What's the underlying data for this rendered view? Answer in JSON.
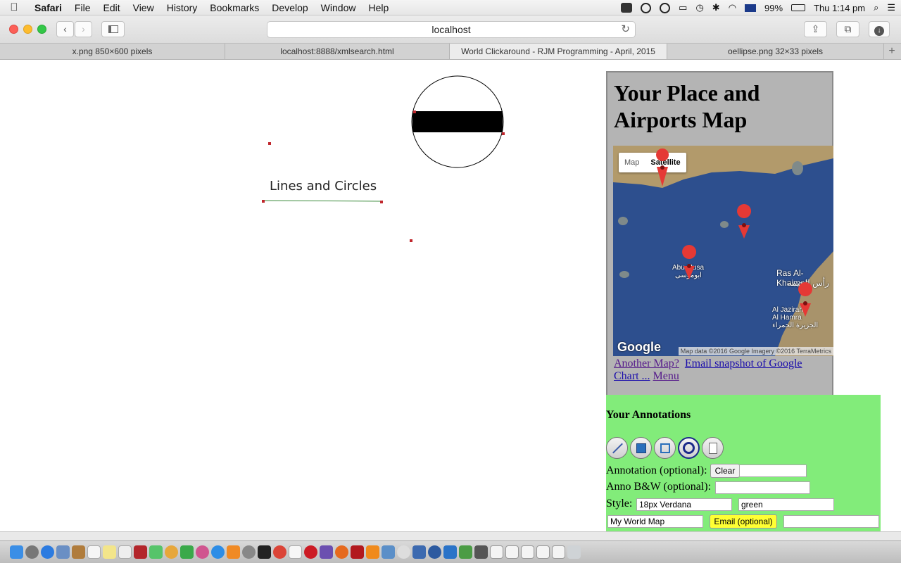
{
  "menubar": {
    "app": "Safari",
    "items": [
      "File",
      "Edit",
      "View",
      "History",
      "Bookmarks",
      "Develop",
      "Window",
      "Help"
    ],
    "battery": "99%",
    "clock": "Thu 1:14 pm"
  },
  "toolbar": {
    "url": "localhost"
  },
  "tabs": [
    {
      "label": "x.png 850×600 pixels",
      "active": false
    },
    {
      "label": "localhost:8888/xmlsearch.html",
      "active": false
    },
    {
      "label": "World Clickaround - RJM Programming - April, 2015",
      "active": true
    },
    {
      "label": "oellipse.png 32×33 pixels",
      "active": false
    }
  ],
  "drawing": {
    "annotation_text": "Lines and Circles",
    "line_color": "#3a8a3a",
    "marker_color": "#c0272d"
  },
  "side": {
    "title": "Your Place and Airports Map",
    "map": {
      "maptype_map": "Map",
      "maptype_satellite": "Satellite",
      "google": "Google",
      "attribution": "Map data ©2016 Google Imagery ©2016 TerraMetrics",
      "labels": [
        {
          "text": "Ras Al-Khaimah"
        },
        {
          "text": "رأس الخيمة"
        },
        {
          "text": "Abu Musa"
        },
        {
          "text": "ابوموسى"
        },
        {
          "text": "Al Jazirah"
        },
        {
          "text": "Al Hamra"
        },
        {
          "text": "الجزيرة الحمراء"
        }
      ]
    },
    "links": {
      "another_map": "Another Map?",
      "email_snapshot": "Email snapshot of Google Chart ...",
      "menu": "Menu"
    }
  },
  "annotations": {
    "heading": "Your Annotations",
    "annotation_label": "Annotation (optional):",
    "clear_button": "Clear",
    "annotation_value": "",
    "anno_bw_label": "Anno B&W (optional):",
    "anno_bw_value": "",
    "style_label": "Style:",
    "style_font": "18px Verdana",
    "style_color": "green",
    "map_title_value": "My World Map",
    "email_button": "Email (optional)",
    "email_value": ""
  }
}
